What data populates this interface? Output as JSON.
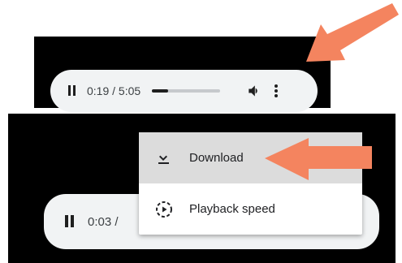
{
  "player_top": {
    "time_display": "0:19 / 5:05",
    "progress_fraction": 0.24,
    "play_state_icon": "pause-icon",
    "volume_icon": "volume-icon",
    "more_icon": "more-vert-icon"
  },
  "player_bottom": {
    "time_display": "0:03 /",
    "play_state_icon": "pause-icon"
  },
  "menu": {
    "items": [
      {
        "label": "Download",
        "icon": "download-icon",
        "highlighted": true
      },
      {
        "label": "Playback speed",
        "icon": "playback-speed-icon",
        "highlighted": false
      }
    ]
  },
  "annotations": {
    "arrow_color": "#f4845f"
  },
  "colors": {
    "background": "#ffffff",
    "panel": "#000000",
    "player_bg": "#f1f3f4",
    "menu_highlight": "#dcdcdc",
    "progress_track": "#c6c9cc",
    "progress_fill": "#1f1f1f"
  }
}
